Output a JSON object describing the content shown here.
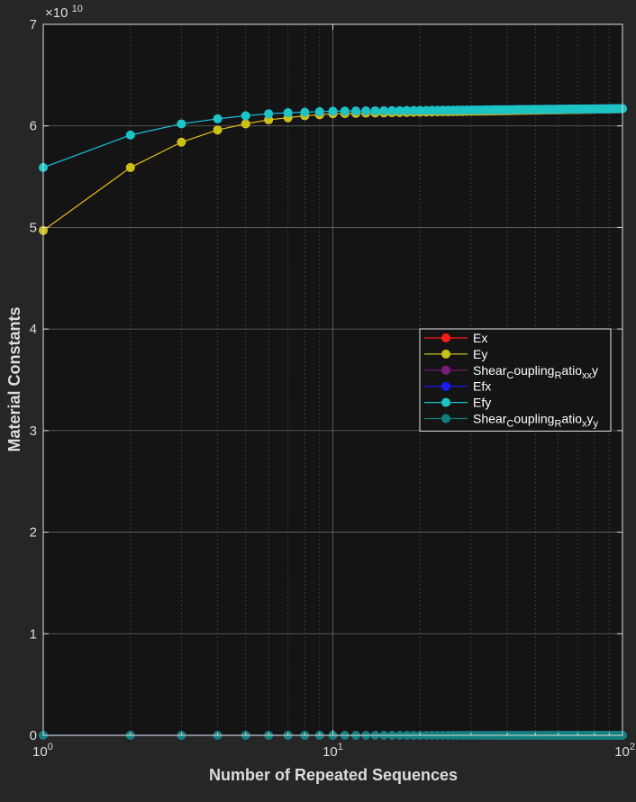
{
  "colors": {
    "figure_bg": "#262626",
    "axes_bg": "#141414",
    "axis_text": "#dcdcdc",
    "grid": "#8a8a8a",
    "legend_bg": "#141414",
    "legend_border": "#e8e8e8"
  },
  "chart_data": {
    "type": "line",
    "title": "",
    "xlabel": "Number of Repeated Sequences",
    "ylabel": "Material Constants",
    "xscale": "log",
    "xlim": [
      1,
      100
    ],
    "ylim": [
      0,
      70000000000
    ],
    "y_exponent_label": "×10",
    "y_exponent_value": "10",
    "x_tick_base": "10",
    "x_ticks": [
      {
        "base": "10",
        "exp": "0",
        "value": 1
      },
      {
        "base": "10",
        "exp": "1",
        "value": 10
      },
      {
        "base": "10",
        "exp": "2",
        "value": 100
      }
    ],
    "y_ticks": [
      "0",
      "1",
      "2",
      "3",
      "4",
      "5",
      "6",
      "7"
    ],
    "grid": "major and minor on",
    "legend_position": "middle-right",
    "series": [
      {
        "name": "Ex",
        "color": "#ff1a1a",
        "formula": "same as Ey",
        "values_note": "hidden beneath Ey"
      },
      {
        "name": "Ey",
        "color": "#c8c11a",
        "y_at_n": {
          "1": 49700000000,
          "2": 55900000000,
          "3": 58400000000,
          "4": 59600000000,
          "5": 60200000000,
          "6": 60600000000,
          "7": 60800000000,
          "8": 61000000000,
          "9": 61100000000,
          "10": 61200000000,
          "100": 61700000000
        }
      },
      {
        "name": "Shear_coupling_ratio_xy",
        "label_parts": [
          "Shear",
          "C",
          "oupling",
          "R",
          "atio",
          "xx",
          "y"
        ],
        "color": "#7a1a7a",
        "value": 0
      },
      {
        "name": "Efx",
        "color": "#1a1aff",
        "values_note": "hidden beneath Efy"
      },
      {
        "name": "Efy",
        "color": "#1cc4c4",
        "y_at_n": {
          "1": 55900000000,
          "2": 59100000000,
          "3": 60200000000,
          "4": 60700000000,
          "5": 61000000000,
          "6": 61200000000,
          "7": 61300000000,
          "8": 61350000000,
          "9": 61400000000,
          "10": 61450000000,
          "100": 61700000000
        }
      },
      {
        "name": "Shear_coupling_ratio_yy",
        "label_parts": [
          "Shear",
          "C",
          "oupling",
          "R",
          "atio",
          "x",
          "y",
          "y"
        ],
        "color": "#128080",
        "value": 0
      }
    ],
    "x": "integers 1 to 100"
  }
}
